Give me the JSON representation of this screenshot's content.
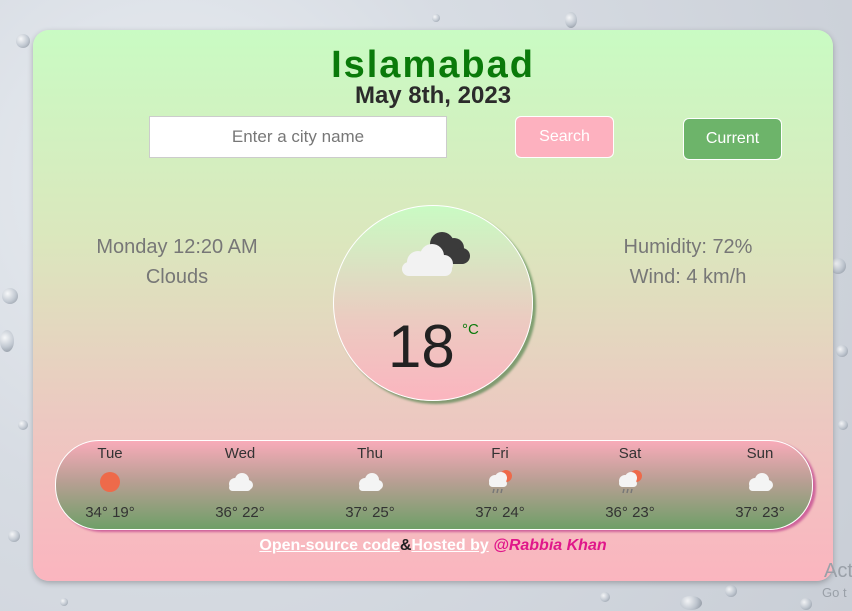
{
  "city": "Islamabad",
  "date": "May 8th, 2023",
  "search": {
    "placeholder": "Enter a city name",
    "value": ""
  },
  "buttons": {
    "search": "Search",
    "current": "Current"
  },
  "now": {
    "datetime": "Monday 12:20 AM",
    "condition": "Clouds",
    "icon": "cloud-icon",
    "temperature": "18",
    "unit": "°C"
  },
  "details": {
    "humidity": "Humidity: 72%",
    "wind": "Wind: 4 km/h"
  },
  "forecast": [
    {
      "day": "Tue",
      "temps": "34° 19°",
      "icon": "sun-icon"
    },
    {
      "day": "Wed",
      "temps": "36° 22°",
      "icon": "cloud-icon"
    },
    {
      "day": "Thu",
      "temps": "37° 25°",
      "icon": "cloud-icon"
    },
    {
      "day": "Fri",
      "temps": "37° 24°",
      "icon": "rain-sun-icon"
    },
    {
      "day": "Sat",
      "temps": "36° 23°",
      "icon": "rain-sun-icon"
    },
    {
      "day": "Sun",
      "temps": "37° 23°",
      "icon": "cloud-icon"
    }
  ],
  "footer": {
    "source": "Open-source code",
    "amp": "&",
    "hosted": "Hosted by",
    "author": "@Rabbia Khan"
  },
  "watermark": {
    "line1": "Act",
    "line2": "Go t"
  },
  "colors": {
    "city": "#0a7a0a",
    "search_btn": "#fdb1bf",
    "current_btn": "#6db46a",
    "author": "#e0168a"
  }
}
